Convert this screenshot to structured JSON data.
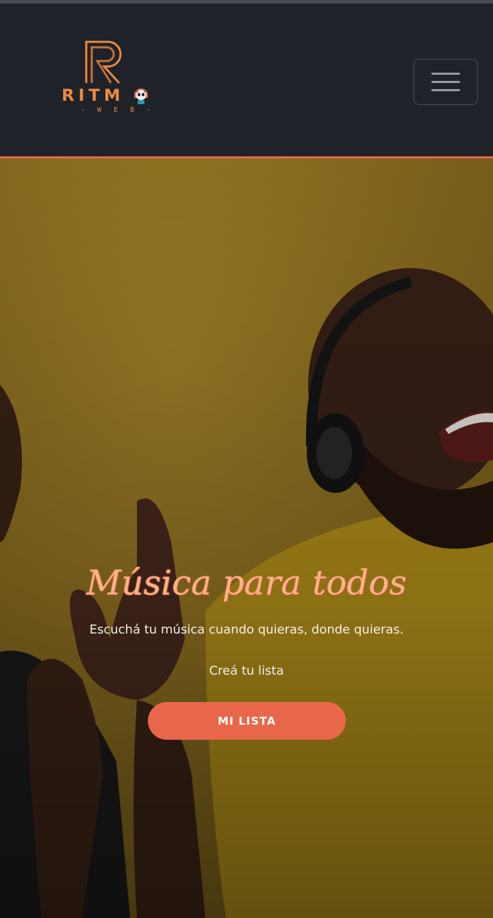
{
  "brand": {
    "name": "RITM",
    "subtitle": "- W E B -",
    "accent_color": "#e8674a",
    "logo_icon": "letter-r-mark",
    "mascot_icon": "panda-headphones-icon"
  },
  "header": {
    "menu_icon": "hamburger-menu-icon"
  },
  "hero": {
    "title": "Música para todos",
    "subtitle": "Escuchá tu música cuando quieras, donde quieras.",
    "tagline": "Creá tu lista",
    "cta_label": "MI LISTA",
    "background_image": "photo of people dancing with headphones on yellow background"
  }
}
